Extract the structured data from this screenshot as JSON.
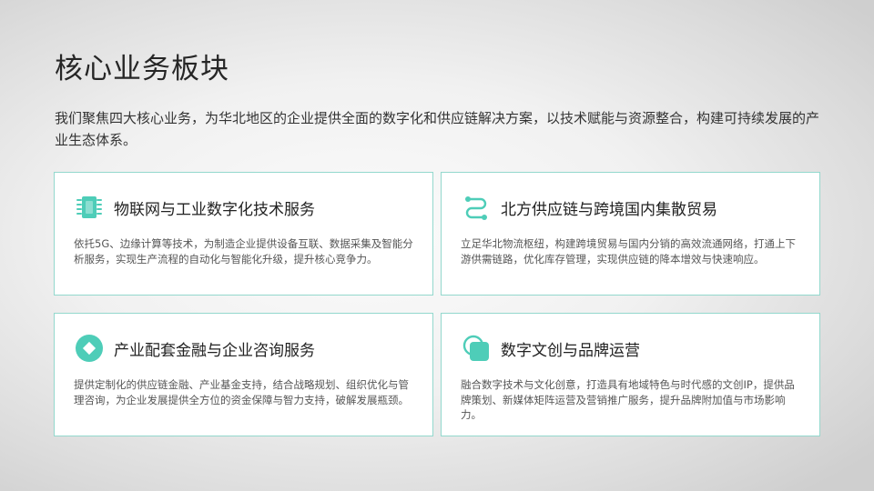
{
  "page": {
    "title": "核心业务板块",
    "intro": "我们聚焦四大核心业务，为华北地区的企业提供全面的数字化和供应链解决方案，以技术赋能与资源整合，构建可持续发展的产业生态体系。"
  },
  "colors": {
    "accent": "#4ecdb8",
    "card_border": "#93d8cd"
  },
  "cards": [
    {
      "icon": "chip-icon",
      "title": "物联网与工业数字化技术服务",
      "description": "依托5G、边缘计算等技术，为制造企业提供设备互联、数据采集及智能分析服务，实现生产流程的自动化与智能化升级，提升核心竞争力。"
    },
    {
      "icon": "route-icon",
      "title": "北方供应链与跨境国内集散贸易",
      "description": "立足华北物流枢纽，构建跨境贸易与国内分销的高效流通网络，打通上下游供需链路，优化库存管理，实现供应链的降本增效与快速响应。"
    },
    {
      "icon": "finance-icon",
      "title": "产业配套金融与企业咨询服务",
      "description": "提供定制化的供应链金融、产业基金支持，结合战略规划、组织优化与管理咨询，为企业发展提供全方位的资金保障与智力支持，破解发展瓶颈。"
    },
    {
      "icon": "brand-icon",
      "title": "数字文创与品牌运营",
      "description": "融合数字技术与文化创意，打造具有地域特色与时代感的文创IP，提供品牌策划、新媒体矩阵运营及营销推广服务，提升品牌附加值与市场影响力。"
    }
  ]
}
